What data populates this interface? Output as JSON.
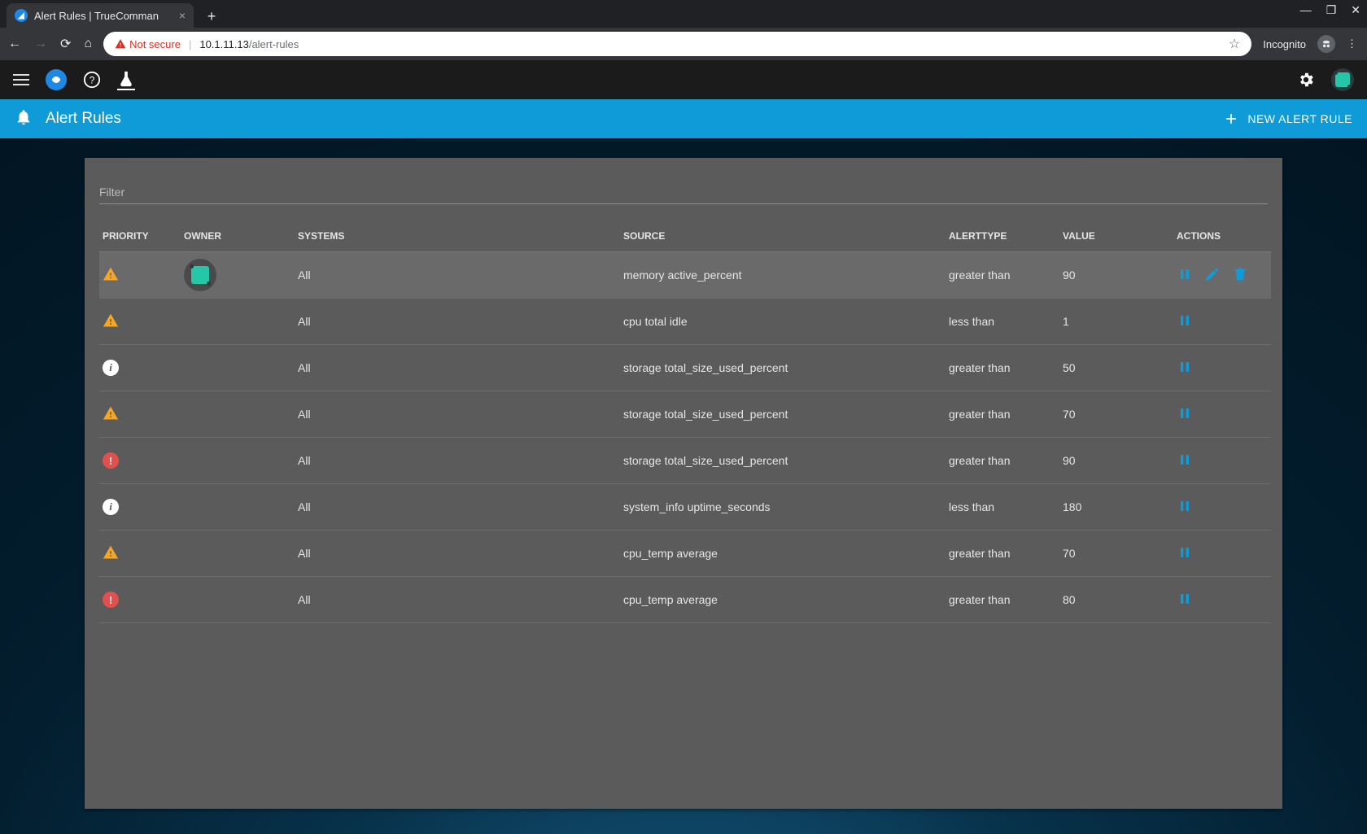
{
  "browser": {
    "tab_title": "Alert Rules | TrueComman",
    "not_secure": "Not secure",
    "url_host": "10.1.11.13",
    "url_path": "/alert-rules",
    "incognito": "Incognito"
  },
  "header": {
    "title": "Alert Rules",
    "new_rule": "NEW ALERT RULE"
  },
  "filter": {
    "placeholder": "Filter"
  },
  "columns": {
    "priority": "PRIORITY",
    "owner": "OWNER",
    "systems": "SYSTEMS",
    "source": "SOURCE",
    "alerttype": "ALERTTYPE",
    "value": "VALUE",
    "actions": "ACTIONS"
  },
  "rows": [
    {
      "priority": "warning",
      "owner": "user",
      "systems": "All",
      "source": "memory active_percent",
      "alerttype": "greater than",
      "value": "90",
      "actions": [
        "pause",
        "edit",
        "delete"
      ],
      "hover": true
    },
    {
      "priority": "warning",
      "owner": "",
      "systems": "All",
      "source": "cpu total idle",
      "alerttype": "less than",
      "value": "1",
      "actions": [
        "pause"
      ]
    },
    {
      "priority": "info",
      "owner": "",
      "systems": "All",
      "source": "storage total_size_used_percent",
      "alerttype": "greater than",
      "value": "50",
      "actions": [
        "pause"
      ]
    },
    {
      "priority": "warning",
      "owner": "",
      "systems": "All",
      "source": "storage total_size_used_percent",
      "alerttype": "greater than",
      "value": "70",
      "actions": [
        "pause"
      ]
    },
    {
      "priority": "critical",
      "owner": "",
      "systems": "All",
      "source": "storage total_size_used_percent",
      "alerttype": "greater than",
      "value": "90",
      "actions": [
        "pause"
      ]
    },
    {
      "priority": "info",
      "owner": "",
      "systems": "All",
      "source": "system_info uptime_seconds",
      "alerttype": "less than",
      "value": "180",
      "actions": [
        "pause"
      ]
    },
    {
      "priority": "warning",
      "owner": "",
      "systems": "All",
      "source": "cpu_temp average",
      "alerttype": "greater than",
      "value": "70",
      "actions": [
        "pause"
      ]
    },
    {
      "priority": "critical",
      "owner": "",
      "systems": "All",
      "source": "cpu_temp average",
      "alerttype": "greater than",
      "value": "80",
      "actions": [
        "pause"
      ]
    }
  ]
}
